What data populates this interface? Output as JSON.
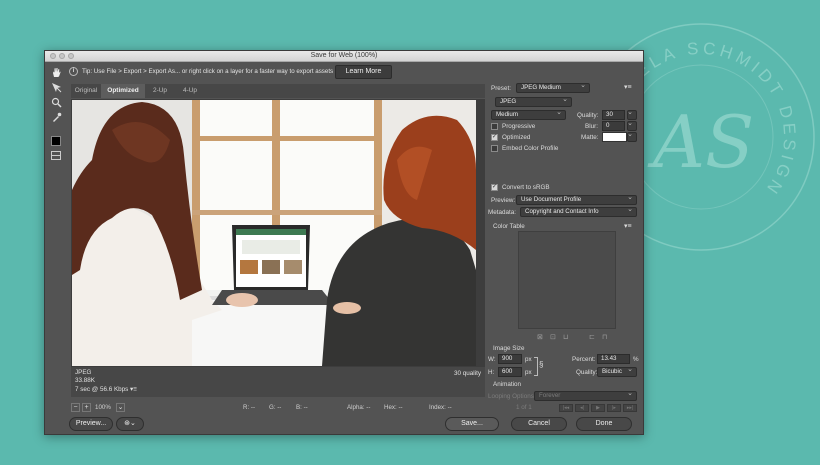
{
  "watermark": {
    "text": "ANGELA SCHMIDT DESIGN",
    "monogram": "AS"
  },
  "window": {
    "title": "Save for Web (100%)"
  },
  "tools": [
    "hand-icon",
    "slice-select-icon",
    "zoom-icon",
    "eyedropper-icon",
    "color-swatch",
    "toggle-slices-icon"
  ],
  "tip": {
    "icon": "i",
    "text": "Tip: Use File > Export > Export As...  or right click on a layer for a faster way to export assets",
    "button": "Learn More"
  },
  "tabs": [
    {
      "label": "Original",
      "active": false
    },
    {
      "label": "Optimized",
      "active": true
    },
    {
      "label": "2-Up",
      "active": false
    },
    {
      "label": "4-Up",
      "active": false
    }
  ],
  "preview_info": {
    "format": "JPEG",
    "size": "33.88K",
    "time": "7 sec @ 56.6 Kbps",
    "time_menu": "▾≡",
    "quality": "30 quality"
  },
  "status": {
    "zoom": "100%",
    "r": "R: --",
    "g": "G: --",
    "b": "B: --",
    "alpha": "Alpha: --",
    "hex": "Hex: --",
    "index": "Index: --"
  },
  "panel": {
    "preset_label": "Preset:",
    "preset_value": "JPEG Medium",
    "format_value": "JPEG",
    "compression_value": "Medium",
    "quality_label": "Quality:",
    "quality_value": "30",
    "progressive_label": "Progressive",
    "progressive_checked": false,
    "blur_label": "Blur:",
    "blur_value": "0",
    "optimized_label": "Optimized",
    "optimized_checked": true,
    "matte_label": "Matte:",
    "embed_label": "Embed Color Profile",
    "embed_checked": false,
    "convert_label": "Convert to sRGB",
    "convert_checked": true,
    "preview_label": "Preview:",
    "preview_value": "Use Document Profile",
    "metadata_label": "Metadata:",
    "metadata_value": "Copyright and Contact Info",
    "color_table_label": "Color Table",
    "image_size_label": "Image Size",
    "w_label": "W:",
    "w_value": "900",
    "h_label": "H:",
    "h_value": "600",
    "px": "px",
    "percent_label": "Percent:",
    "percent_value": "13.43",
    "percent_unit": "%",
    "resample_label": "Quality:",
    "resample_value": "Bicubic",
    "animation_label": "Animation",
    "looping_label": "Looping Options:",
    "looping_value": "Forever",
    "frame_counter": "1 of 1"
  },
  "buttons": {
    "preview": "Preview...",
    "save": "Save...",
    "cancel": "Cancel",
    "done": "Done"
  }
}
